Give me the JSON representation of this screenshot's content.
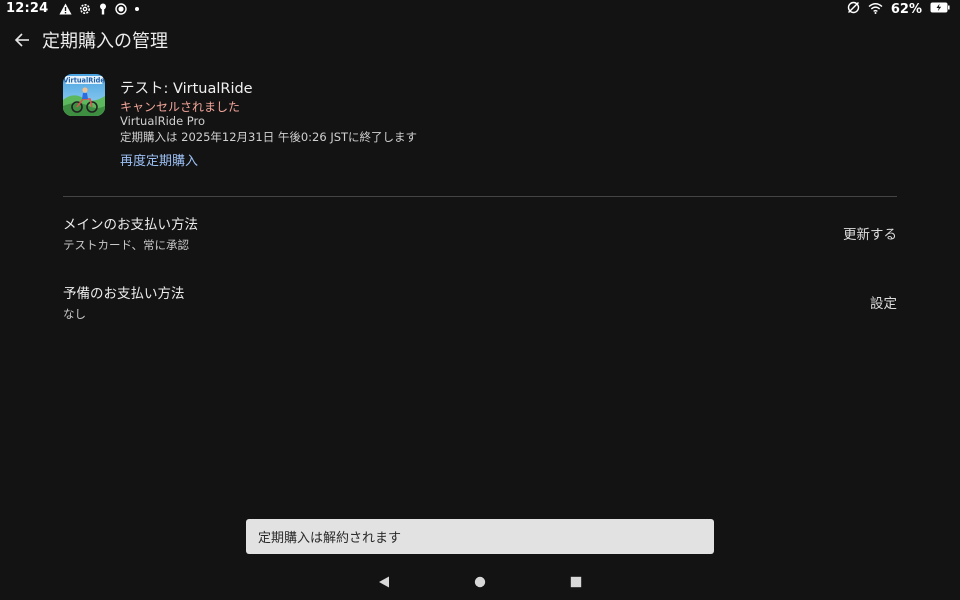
{
  "status_bar": {
    "time": "12:24",
    "battery_percent": "62%",
    "icons_left": [
      "warning-icon",
      "gear-icon",
      "key-icon",
      "record-icon",
      "dot-icon"
    ],
    "icons_right": [
      "no-sim-icon",
      "wifi-icon",
      "battery-charging-icon"
    ]
  },
  "app_bar": {
    "back_icon": "arrow-left-icon",
    "title": "定期購入の管理"
  },
  "subscription": {
    "app_icon": "virtualride-app-icon",
    "app_icon_text": "VirtualRide",
    "title": "テスト: VirtualRide",
    "status": "キャンセルされました",
    "product": "VirtualRide Pro",
    "end_info": "定期購入は 2025年12月31日 午後0:26 JSTに終了します",
    "resubscribe_label": "再度定期購入"
  },
  "payment": {
    "primary": {
      "title": "メインのお支払い方法",
      "value": "テストカード、常に承認",
      "action": "更新する"
    },
    "backup": {
      "title": "予備のお支払い方法",
      "value": "なし",
      "action": "設定"
    }
  },
  "snackbar": {
    "message": "定期購入は解約されます"
  },
  "nav_bar": {
    "buttons": [
      "back-triangle-icon",
      "home-circle-icon",
      "recents-square-icon"
    ]
  },
  "colors": {
    "background": "#131313",
    "cancelled_status": "#f2a59a",
    "link": "#9cc0f5",
    "snackbar_bg": "#e2e2e2"
  }
}
